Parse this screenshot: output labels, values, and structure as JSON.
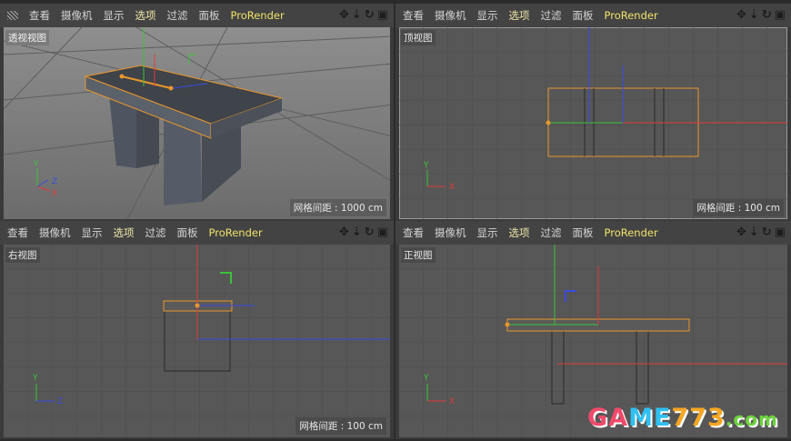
{
  "menu": [
    "查看",
    "摄像机",
    "显示",
    "选项",
    "过滤",
    "面板",
    "ProRender"
  ],
  "header_icons": [
    "move-view-icon",
    "zoom-view-icon",
    "rotate-view-icon",
    "toggle-layout-icon"
  ],
  "viewports": [
    {
      "name": "透视视图",
      "grid": "网格间距 : 1000 cm"
    },
    {
      "name": "顶视图",
      "grid": "网格间距 : 100 cm"
    },
    {
      "name": "右视图",
      "grid": "网格间距 : 100 cm"
    },
    {
      "name": "正视图",
      "grid": "网格间距 : 100 cm"
    }
  ],
  "axes": {
    "x": "X",
    "y": "Y",
    "z": "Z"
  },
  "colors": {
    "selection": "#e8962c",
    "x_axis": "#e03a3a",
    "y_axis": "#3ac23a",
    "z_axis": "#3a4ae0",
    "highlight_menu": "#f0e36a"
  },
  "watermark": "GAME773.com"
}
